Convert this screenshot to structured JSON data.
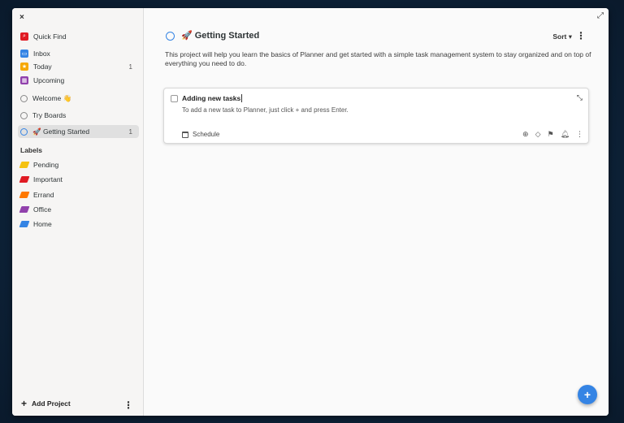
{
  "sidebar": {
    "close": "×",
    "quick_find": "Quick Find",
    "inbox": "Inbox",
    "today": "Today",
    "today_count": "1",
    "upcoming": "Upcoming",
    "projects": [
      {
        "label": "Welcome 👋",
        "count": ""
      },
      {
        "label": "Try Boards",
        "count": ""
      },
      {
        "label": "🚀 Getting Started",
        "count": "1"
      }
    ],
    "labels_title": "Labels",
    "labels": [
      {
        "label": "Pending",
        "color": "#f5c211"
      },
      {
        "label": "Important",
        "color": "#e01b24"
      },
      {
        "label": "Errand",
        "color": "#ff7800"
      },
      {
        "label": "Office",
        "color": "#9141ac"
      },
      {
        "label": "Home",
        "color": "#3584e4"
      }
    ],
    "add_project": "Add Project",
    "more": "⋮"
  },
  "main": {
    "title": "🚀 Getting Started",
    "sort_label": "Sort",
    "sort_caret": "▾",
    "more": "⋮",
    "expand": "⤢",
    "description": "This project will help you learn the basics of Planner and get started with a simple task management system to stay organized and on top of everything you need to do.",
    "task": {
      "title": "Adding new tasks",
      "note": "To add a new task to Planner, just click + and press Enter.",
      "schedule": "Schedule",
      "collapse": "⤡"
    },
    "fab": "+"
  },
  "colors": {
    "accent": "#3584e4",
    "quick_find": "#e01b24",
    "inbox": "#3584e4",
    "today": "#f6a800",
    "upcoming": "#9141ac"
  }
}
